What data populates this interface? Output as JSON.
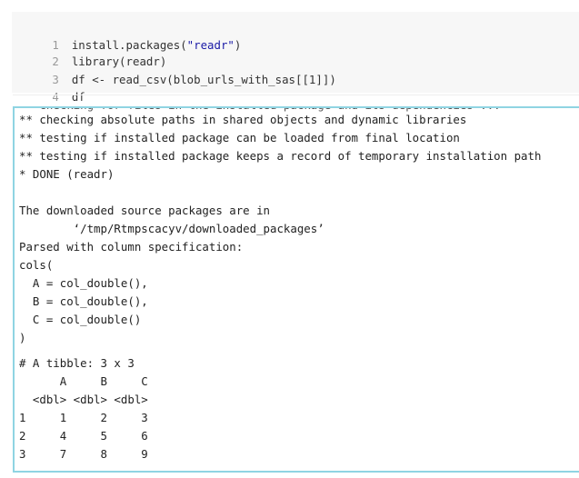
{
  "code_cell": {
    "lines": [
      {
        "num": "1",
        "pre": "install.packages(",
        "str": "\"readr\"",
        "post": ")"
      },
      {
        "num": "2",
        "text": "library(readr)"
      },
      {
        "num": "3",
        "text": "df <- read_csv(blob_urls_with_sas[[1]])"
      },
      {
        "num": "4",
        "text": "df"
      }
    ]
  },
  "output": {
    "clipped_line": "** checking for files in the installed package and its dependencies ...",
    "lines": [
      "** checking absolute paths in shared objects and dynamic libraries",
      "** testing if installed package can be loaded from final location",
      "** testing if installed package keeps a record of temporary installation path",
      "* DONE (readr)",
      "",
      "The downloaded source packages are in",
      "        ‘/tmp/Rtmpscacyv/downloaded_packages’",
      "Parsed with column specification:",
      "cols(",
      "  A = col_double(),",
      "  B = col_double(),",
      "  C = col_double()",
      ")",
      "",
      "# A tibble: 3 x 3",
      "      A     B     C",
      "  <dbl> <dbl> <dbl>",
      "1     1     2     3",
      "2     4     5     6",
      "3     7     8     9"
    ]
  }
}
